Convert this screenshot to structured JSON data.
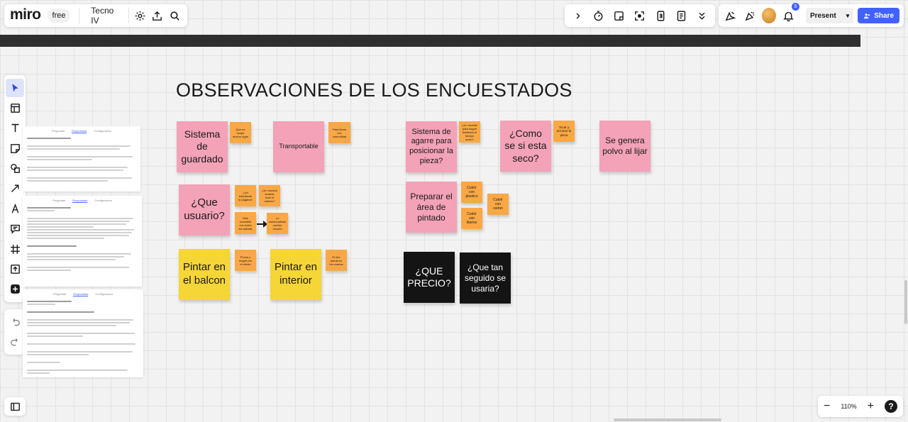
{
  "app": {
    "logo": "miro",
    "plan_badge": "free",
    "board_name": "Tecno IV"
  },
  "header_right": {
    "notification_count": "5",
    "present_label": "Present",
    "share_label": "Share"
  },
  "zoom": {
    "level": "110%",
    "minus": "−",
    "plus": "+",
    "help": "?"
  },
  "board": {
    "title": "OBSERVACIONES DE LOS ENCUESTADOS",
    "doc_tabs": [
      "Preguntas",
      "Respuestas",
      "Configuracion"
    ],
    "stickies": [
      {
        "id": "s1",
        "text": "Sistema de guardado",
        "color": "pink"
      },
      {
        "id": "s2",
        "text": "Que no ocupe mucho lugar",
        "color": "orange"
      },
      {
        "id": "s3",
        "text": "Transportable",
        "color": "pink"
      },
      {
        "id": "s4",
        "text": "Para llevar con comodidad",
        "color": "orange"
      },
      {
        "id": "s5",
        "text": "¿Que usuario?",
        "color": "pink"
      },
      {
        "id": "s6",
        "text": "¿Un estudiante lo pagaria?",
        "color": "orange"
      },
      {
        "id": "s7",
        "text": "¿Un usuario durante todo el camino?",
        "color": "orange"
      },
      {
        "id": "s8",
        "text": "Mas accesible con todos los artistas",
        "color": "orange"
      },
      {
        "id": "s9",
        "text": "Lo comercializan con/sin usuario",
        "color": "orange"
      },
      {
        "id": "s10",
        "text": "Pintar en el balcon",
        "color": "yellow"
      },
      {
        "id": "s11",
        "text": "Pocos y mugre por el viento",
        "color": "orange"
      },
      {
        "id": "s12",
        "text": "Pintar en interior",
        "color": "yellow"
      },
      {
        "id": "s13",
        "text": "El olor queda en los cuartos",
        "color": "orange"
      },
      {
        "id": "s14",
        "text": "Sistema de agarre para posicionar la pieza?",
        "color": "pink"
      },
      {
        "id": "s15",
        "text": "¿Un mueble para seguir limitando el tiempo sucio?",
        "color": "orange"
      },
      {
        "id": "s16",
        "text": "¿Como se si esta seco?",
        "color": "pink"
      },
      {
        "id": "s17",
        "text": "Tocar y arruinar la pieza",
        "color": "orange"
      },
      {
        "id": "s18",
        "text": "Se genera polvo al lijar",
        "color": "pink"
      },
      {
        "id": "s19",
        "text": "Preparar el área de pintado",
        "color": "pink"
      },
      {
        "id": "s20",
        "text": "Cubrir con plastico",
        "color": "orange"
      },
      {
        "id": "s21",
        "text": "Cubrir con carton",
        "color": "orange"
      },
      {
        "id": "s22",
        "text": "Cubrir con diarios",
        "color": "orange"
      },
      {
        "id": "s23",
        "text": "¿QUE PRECIO?",
        "color": "black"
      },
      {
        "id": "s24",
        "text": "¿Que tan seguido se usaria?",
        "color": "black"
      }
    ]
  }
}
